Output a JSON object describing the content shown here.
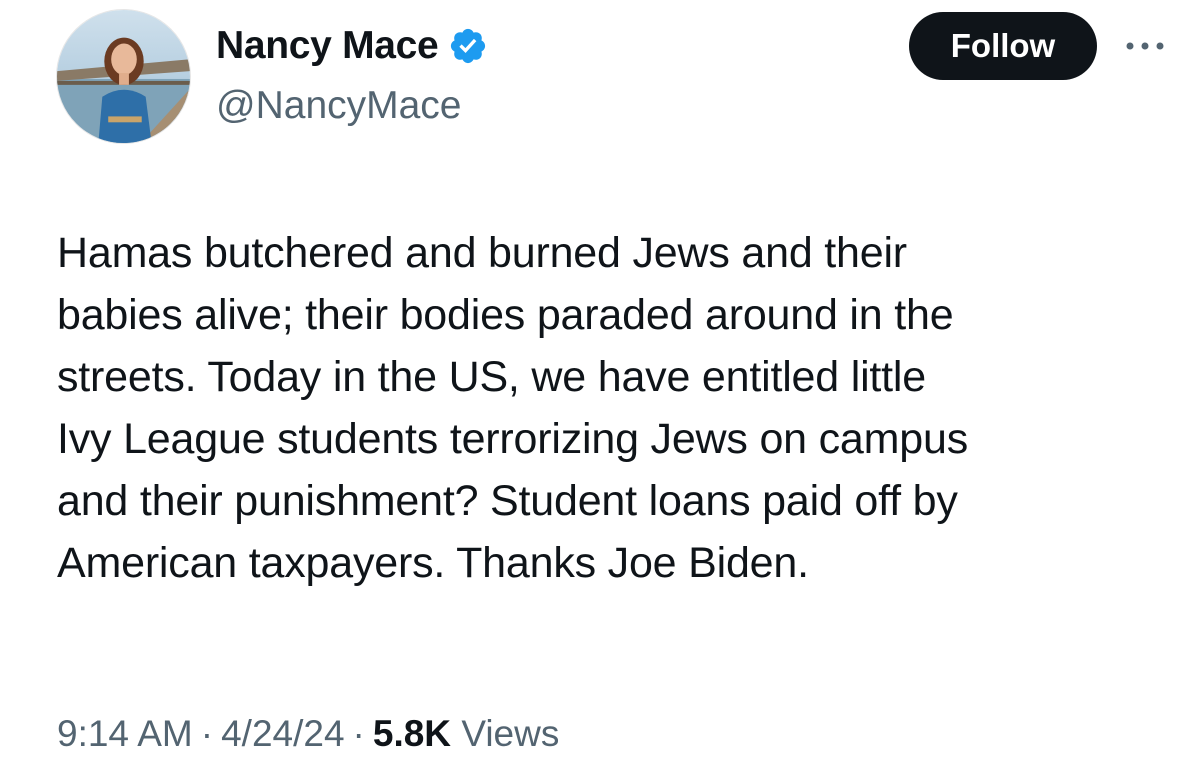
{
  "author": {
    "display_name": "Nancy Mace",
    "handle": "@NancyMace",
    "verified_color": "#1d9bf0",
    "avatar_icon": "profile-photo"
  },
  "actions": {
    "follow_label": "Follow",
    "more_icon": "more-horizontal-icon"
  },
  "tweet": {
    "lines": [
      "Hamas butchered and burned Jews and their",
      "babies alive; their bodies paraded around in the",
      "streets. Today in the US, we have entitled little",
      "Ivy League students terrorizing Jews on campus",
      "and their punishment? Student loans paid off by",
      "American taxpayers. Thanks Joe Biden."
    ]
  },
  "meta": {
    "time": "9:14 AM",
    "separator": "·",
    "date": "4/24/24",
    "views_count": "5.8K",
    "views_label": "Views"
  },
  "colors": {
    "text_primary": "#0f1419",
    "text_secondary": "#536471",
    "button_bg": "#0f1419",
    "button_text": "#ffffff"
  }
}
